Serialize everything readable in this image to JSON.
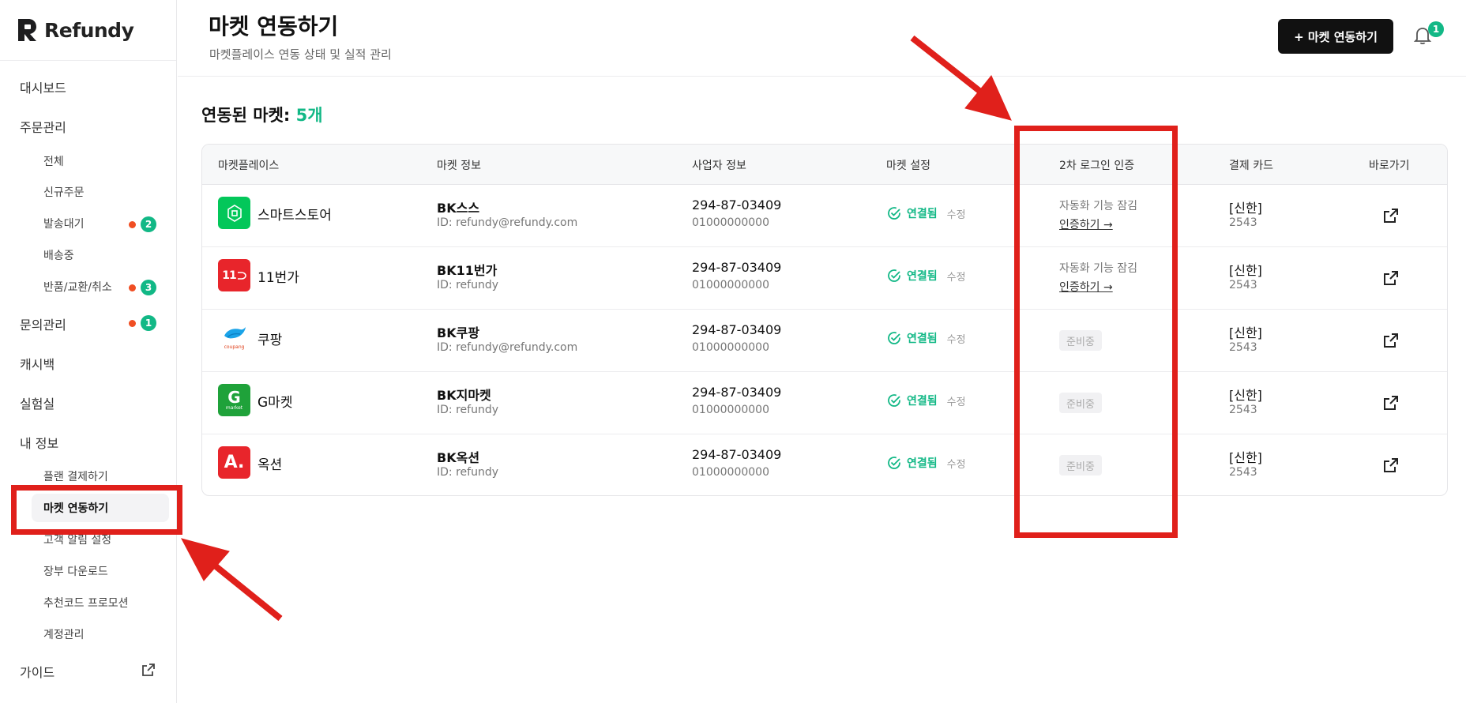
{
  "app": {
    "logo_text": "Refundy"
  },
  "sidebar": {
    "items": [
      {
        "label": "대시보드"
      },
      {
        "label": "주문관리"
      },
      {
        "label": "전체"
      },
      {
        "label": "신규주문"
      },
      {
        "label": "발송대기",
        "badge": "2"
      },
      {
        "label": "배송중"
      },
      {
        "label": "반품/교환/취소",
        "badge": "3"
      },
      {
        "label": "문의관리",
        "badge": "1"
      },
      {
        "label": "캐시백"
      },
      {
        "label": "실험실"
      },
      {
        "label": "내 정보"
      },
      {
        "label": "플랜 결제하기"
      },
      {
        "label": "마켓 연동하기"
      },
      {
        "label": "고객 알림 설정"
      },
      {
        "label": "장부 다운로드"
      },
      {
        "label": "추천코드 프로모션"
      },
      {
        "label": "계정관리"
      },
      {
        "label": "가이드"
      }
    ]
  },
  "header": {
    "title": "마켓 연동하기",
    "subtitle": "마켓플레이스 연동 상태 및 실적 관리",
    "primary_button": "+ 마켓 연동하기",
    "notification_count": "1"
  },
  "main": {
    "heading_prefix": "연동된 마켓: ",
    "heading_count": "5개",
    "columns": [
      "마켓플레이스",
      "마켓 정보",
      "사업자 정보",
      "마켓 설정",
      "2차 로그인 인증",
      "결제 카드",
      "바로가기"
    ],
    "rows": [
      {
        "market": "스마트스토어",
        "logo_label": "SmartStore",
        "logo_color": "#03c75a",
        "info_name": "BK스스",
        "info_id": "ID: refundy@refundy.com",
        "biz_no": "294-87-03409",
        "biz_phone": "01000000000",
        "status": "연결됨",
        "edit": "수정",
        "auth_lock": "자동화 기능 잠김",
        "auth_link": "인증하기 →",
        "card_name": "[신한]",
        "card_no": "2543"
      },
      {
        "market": "11번가",
        "logo_label": "11",
        "logo_color": "#e8252b",
        "info_name": "BK11번가",
        "info_id": "ID: refundy",
        "biz_no": "294-87-03409",
        "biz_phone": "01000000000",
        "status": "연결됨",
        "edit": "수정",
        "auth_lock": "자동화 기능 잠김",
        "auth_link": "인증하기 →",
        "card_name": "[신한]",
        "card_no": "2543"
      },
      {
        "market": "쿠팡",
        "logo_label": "coupang",
        "logo_color": "#ffffff",
        "info_name": "BK쿠팡",
        "info_id": "ID: refundy@refundy.com",
        "biz_no": "294-87-03409",
        "biz_phone": "01000000000",
        "status": "연결됨",
        "edit": "수정",
        "auth_pill": "준비중",
        "card_name": "[신한]",
        "card_no": "2543"
      },
      {
        "market": "G마켓",
        "logo_label": "G",
        "logo_sub": "market",
        "logo_color": "#1fa23a",
        "info_name": "BK지마켓",
        "info_id": "ID: refundy",
        "biz_no": "294-87-03409",
        "biz_phone": "01000000000",
        "status": "연결됨",
        "edit": "수정",
        "auth_pill": "준비중",
        "card_name": "[신한]",
        "card_no": "2543"
      },
      {
        "market": "옥션",
        "logo_label": "A.",
        "logo_color": "#e8252b",
        "info_name": "BK옥션",
        "info_id": "ID: refundy",
        "biz_no": "294-87-03409",
        "biz_phone": "01000000000",
        "status": "연결됨",
        "edit": "수정",
        "auth_pill": "준비중",
        "card_name": "[신한]",
        "card_no": "2543"
      }
    ]
  },
  "colors": {
    "accent": "#12b886",
    "alert_dot": "#f04e23",
    "annotation": "#e0201b"
  }
}
